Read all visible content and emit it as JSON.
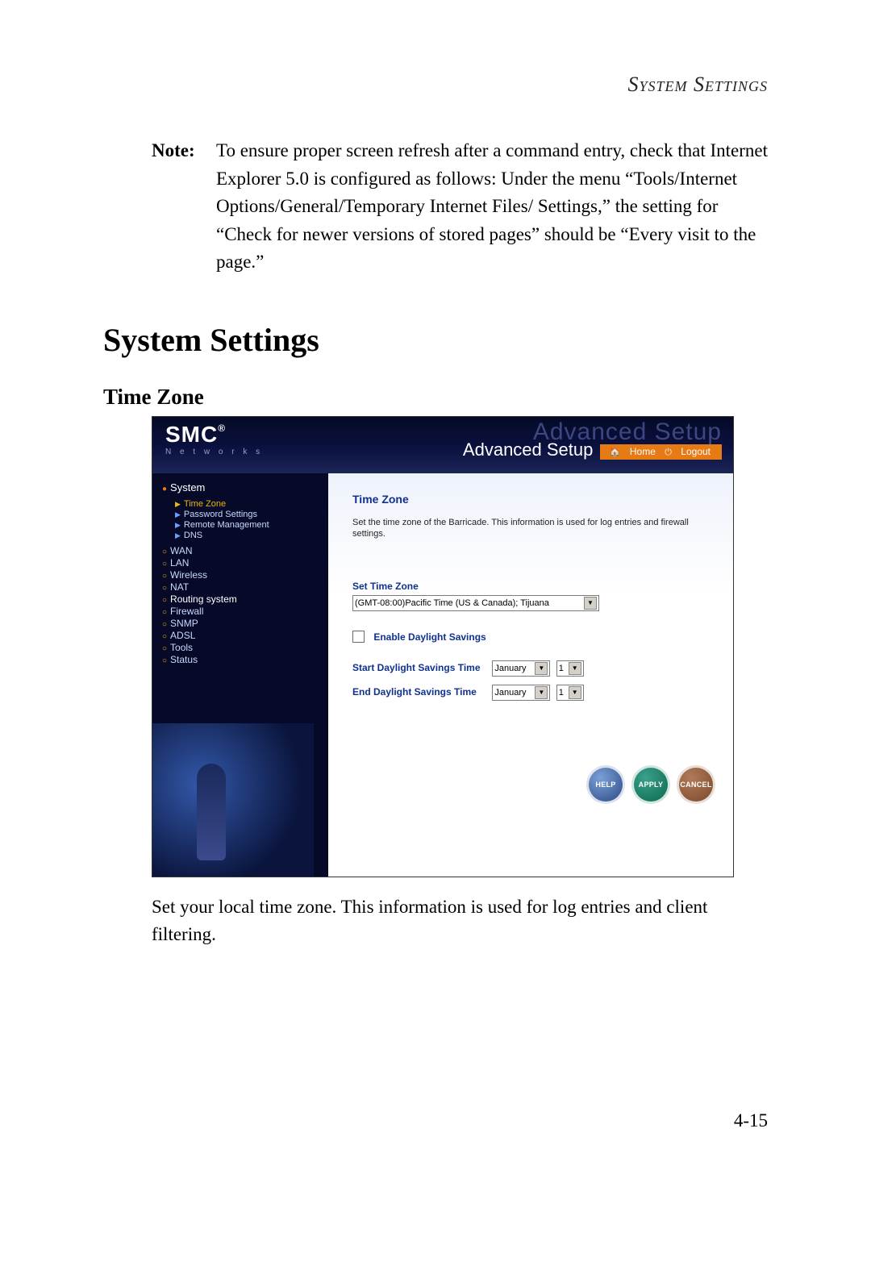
{
  "doc": {
    "running_head": "System Settings",
    "note_label": "Note:",
    "note_body": "To ensure proper screen refresh after a command entry, check that Internet Explorer 5.0 is configured as follows: Under the menu “Tools/Internet Options/General/Temporary Internet Files/ Settings,” the setting for “Check for newer versions of stored pages” should be “Every visit to the page.”",
    "h1": "System Settings",
    "h2": "Time Zone",
    "post_text": "Set your local time zone. This information is used for log entries and client filtering.",
    "page_number": "4-15"
  },
  "ui": {
    "logo_brand": "SMC",
    "logo_reg": "®",
    "logo_sub": "N e t w o r k s",
    "ghost_title": "Advanced Setup",
    "banner_title": "Advanced Setup",
    "top_links": {
      "home": "Home",
      "logout": "Logout"
    },
    "nav": {
      "system": "System",
      "subs": {
        "time_zone": "Time Zone",
        "password": "Password Settings",
        "remote": "Remote Management",
        "dns": "DNS"
      },
      "items": {
        "wan": "WAN",
        "lan": "LAN",
        "wireless": "Wireless",
        "nat": "NAT",
        "routing": "Routing system",
        "firewall": "Firewall",
        "snmp": "SNMP",
        "adsl": "ADSL",
        "tools": "Tools",
        "status": "Status"
      }
    },
    "content": {
      "title": "Time Zone",
      "desc": "Set the time zone of the Barricade.  This information is used for log entries and firewall settings.",
      "set_label": "Set Time Zone",
      "tz_value": "(GMT-08:00)Pacific Time (US & Canada); Tijuana",
      "enable_dst": "Enable Daylight Savings",
      "start_label": "Start Daylight Savings Time",
      "end_label": "End Daylight Savings Time",
      "month_value": "January",
      "day_value": "1",
      "buttons": {
        "help": "HELP",
        "apply": "APPLY",
        "cancel": "CANCEL"
      }
    }
  }
}
